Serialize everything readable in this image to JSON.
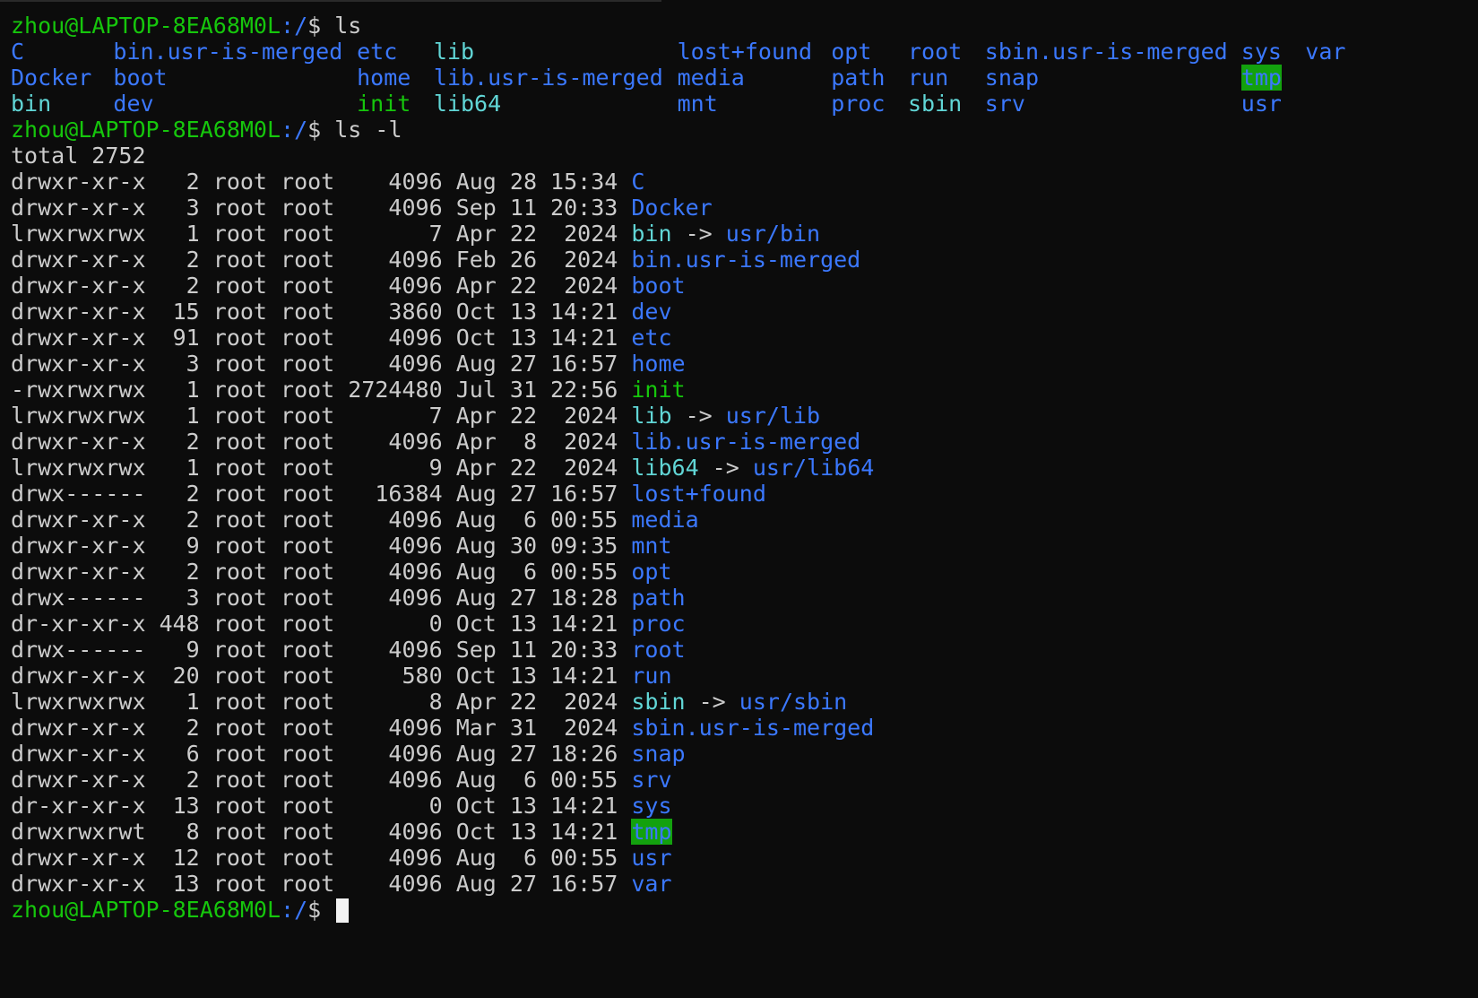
{
  "prompt": {
    "user_host": "zhou@LAPTOP-8EA68M0L",
    "path": ":/",
    "symbol": "$ "
  },
  "commands": [
    "ls",
    "ls -l"
  ],
  "ls_output": {
    "columns": [
      [
        {
          "name": "C",
          "type": "dir"
        },
        {
          "name": "Docker",
          "type": "dir"
        },
        {
          "name": "bin",
          "type": "link"
        }
      ],
      [
        {
          "name": "bin.usr-is-merged",
          "type": "dir"
        },
        {
          "name": "boot",
          "type": "dir"
        },
        {
          "name": "dev",
          "type": "dir"
        }
      ],
      [
        {
          "name": "etc",
          "type": "dir"
        },
        {
          "name": "home",
          "type": "dir"
        },
        {
          "name": "init",
          "type": "exec"
        }
      ],
      [
        {
          "name": "lib",
          "type": "link"
        },
        {
          "name": "lib.usr-is-merged",
          "type": "dir"
        },
        {
          "name": "lib64",
          "type": "link"
        }
      ],
      [
        {
          "name": "lost+found",
          "type": "dir"
        },
        {
          "name": "media",
          "type": "dir"
        },
        {
          "name": "mnt",
          "type": "dir"
        }
      ],
      [
        {
          "name": "opt",
          "type": "dir"
        },
        {
          "name": "path",
          "type": "dir"
        },
        {
          "name": "proc",
          "type": "dir"
        }
      ],
      [
        {
          "name": "root",
          "type": "dir"
        },
        {
          "name": "run",
          "type": "dir"
        },
        {
          "name": "sbin",
          "type": "link"
        }
      ],
      [
        {
          "name": "sbin.usr-is-merged",
          "type": "dir"
        },
        {
          "name": "snap",
          "type": "dir"
        },
        {
          "name": "srv",
          "type": "dir"
        }
      ],
      [
        {
          "name": "sys",
          "type": "dir"
        },
        {
          "name": "tmp",
          "type": "sticky"
        },
        {
          "name": "usr",
          "type": "dir"
        }
      ],
      [
        {
          "name": "var",
          "type": "dir"
        }
      ]
    ]
  },
  "ls_l_output": {
    "total": "total 2752",
    "entries": [
      {
        "perm": "drwxr-xr-x",
        "links": "2",
        "owner": "root",
        "group": "root",
        "size": "4096",
        "date": "Aug 28 15:34",
        "name": "C",
        "type": "dir",
        "target": ""
      },
      {
        "perm": "drwxr-xr-x",
        "links": "3",
        "owner": "root",
        "group": "root",
        "size": "4096",
        "date": "Sep 11 20:33",
        "name": "Docker",
        "type": "dir",
        "target": ""
      },
      {
        "perm": "lrwxrwxrwx",
        "links": "1",
        "owner": "root",
        "group": "root",
        "size": "7",
        "date": "Apr 22  2024",
        "name": "bin",
        "type": "link",
        "target": "usr/bin"
      },
      {
        "perm": "drwxr-xr-x",
        "links": "2",
        "owner": "root",
        "group": "root",
        "size": "4096",
        "date": "Feb 26  2024",
        "name": "bin.usr-is-merged",
        "type": "dir",
        "target": ""
      },
      {
        "perm": "drwxr-xr-x",
        "links": "2",
        "owner": "root",
        "group": "root",
        "size": "4096",
        "date": "Apr 22  2024",
        "name": "boot",
        "type": "dir",
        "target": ""
      },
      {
        "perm": "drwxr-xr-x",
        "links": "15",
        "owner": "root",
        "group": "root",
        "size": "3860",
        "date": "Oct 13 14:21",
        "name": "dev",
        "type": "dir",
        "target": ""
      },
      {
        "perm": "drwxr-xr-x",
        "links": "91",
        "owner": "root",
        "group": "root",
        "size": "4096",
        "date": "Oct 13 14:21",
        "name": "etc",
        "type": "dir",
        "target": ""
      },
      {
        "perm": "drwxr-xr-x",
        "links": "3",
        "owner": "root",
        "group": "root",
        "size": "4096",
        "date": "Aug 27 16:57",
        "name": "home",
        "type": "dir",
        "target": ""
      },
      {
        "perm": "-rwxrwxrwx",
        "links": "1",
        "owner": "root",
        "group": "root",
        "size": "2724480",
        "date": "Jul 31 22:56",
        "name": "init",
        "type": "exec",
        "target": ""
      },
      {
        "perm": "lrwxrwxrwx",
        "links": "1",
        "owner": "root",
        "group": "root",
        "size": "7",
        "date": "Apr 22  2024",
        "name": "lib",
        "type": "link",
        "target": "usr/lib"
      },
      {
        "perm": "drwxr-xr-x",
        "links": "2",
        "owner": "root",
        "group": "root",
        "size": "4096",
        "date": "Apr  8  2024",
        "name": "lib.usr-is-merged",
        "type": "dir",
        "target": ""
      },
      {
        "perm": "lrwxrwxrwx",
        "links": "1",
        "owner": "root",
        "group": "root",
        "size": "9",
        "date": "Apr 22  2024",
        "name": "lib64",
        "type": "link",
        "target": "usr/lib64"
      },
      {
        "perm": "drwx------",
        "links": "2",
        "owner": "root",
        "group": "root",
        "size": "16384",
        "date": "Aug 27 16:57",
        "name": "lost+found",
        "type": "dir",
        "target": ""
      },
      {
        "perm": "drwxr-xr-x",
        "links": "2",
        "owner": "root",
        "group": "root",
        "size": "4096",
        "date": "Aug  6 00:55",
        "name": "media",
        "type": "dir",
        "target": ""
      },
      {
        "perm": "drwxr-xr-x",
        "links": "9",
        "owner": "root",
        "group": "root",
        "size": "4096",
        "date": "Aug 30 09:35",
        "name": "mnt",
        "type": "dir",
        "target": ""
      },
      {
        "perm": "drwxr-xr-x",
        "links": "2",
        "owner": "root",
        "group": "root",
        "size": "4096",
        "date": "Aug  6 00:55",
        "name": "opt",
        "type": "dir",
        "target": ""
      },
      {
        "perm": "drwx------",
        "links": "3",
        "owner": "root",
        "group": "root",
        "size": "4096",
        "date": "Aug 27 18:28",
        "name": "path",
        "type": "dir",
        "target": ""
      },
      {
        "perm": "dr-xr-xr-x",
        "links": "448",
        "owner": "root",
        "group": "root",
        "size": "0",
        "date": "Oct 13 14:21",
        "name": "proc",
        "type": "dir",
        "target": ""
      },
      {
        "perm": "drwx------",
        "links": "9",
        "owner": "root",
        "group": "root",
        "size": "4096",
        "date": "Sep 11 20:33",
        "name": "root",
        "type": "dir",
        "target": ""
      },
      {
        "perm": "drwxr-xr-x",
        "links": "20",
        "owner": "root",
        "group": "root",
        "size": "580",
        "date": "Oct 13 14:21",
        "name": "run",
        "type": "dir",
        "target": ""
      },
      {
        "perm": "lrwxrwxrwx",
        "links": "1",
        "owner": "root",
        "group": "root",
        "size": "8",
        "date": "Apr 22  2024",
        "name": "sbin",
        "type": "link",
        "target": "usr/sbin"
      },
      {
        "perm": "drwxr-xr-x",
        "links": "2",
        "owner": "root",
        "group": "root",
        "size": "4096",
        "date": "Mar 31  2024",
        "name": "sbin.usr-is-merged",
        "type": "dir",
        "target": ""
      },
      {
        "perm": "drwxr-xr-x",
        "links": "6",
        "owner": "root",
        "group": "root",
        "size": "4096",
        "date": "Aug 27 18:26",
        "name": "snap",
        "type": "dir",
        "target": ""
      },
      {
        "perm": "drwxr-xr-x",
        "links": "2",
        "owner": "root",
        "group": "root",
        "size": "4096",
        "date": "Aug  6 00:55",
        "name": "srv",
        "type": "dir",
        "target": ""
      },
      {
        "perm": "dr-xr-xr-x",
        "links": "13",
        "owner": "root",
        "group": "root",
        "size": "0",
        "date": "Oct 13 14:21",
        "name": "sys",
        "type": "dir",
        "target": ""
      },
      {
        "perm": "drwxrwxrwt",
        "links": "8",
        "owner": "root",
        "group": "root",
        "size": "4096",
        "date": "Oct 13 14:21",
        "name": "tmp",
        "type": "sticky",
        "target": ""
      },
      {
        "perm": "drwxr-xr-x",
        "links": "12",
        "owner": "root",
        "group": "root",
        "size": "4096",
        "date": "Aug  6 00:55",
        "name": "usr",
        "type": "dir",
        "target": ""
      },
      {
        "perm": "drwxr-xr-x",
        "links": "13",
        "owner": "root",
        "group": "root",
        "size": "4096",
        "date": "Aug 27 16:57",
        "name": "var",
        "type": "dir",
        "target": ""
      }
    ]
  },
  "symlink_arrow": " -> ",
  "colors": {
    "background": "#0c0c0c",
    "foreground": "#cccccc",
    "prompt_user": "#16c60c",
    "prompt_path": "#3b78ff",
    "directory": "#3b78ff",
    "symlink": "#61d6d6",
    "executable": "#16c60c",
    "sticky_bg": "#13a10e",
    "cursor": "#f2f2f2"
  }
}
